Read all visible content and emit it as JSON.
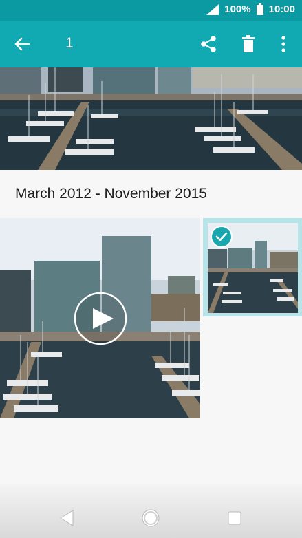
{
  "status": {
    "battery_text": "100%",
    "time": "10:00"
  },
  "app_bar": {
    "selected_count": "1"
  },
  "gallery": {
    "section_title": "March 2012 - November 2015"
  },
  "icons": {
    "back": "arrow-back-icon",
    "share": "share-icon",
    "delete": "trash-icon",
    "more": "more-vert-icon",
    "play": "play-icon",
    "check": "check-circle-icon",
    "nav_back": "triangle-back-icon",
    "nav_home": "circle-home-icon",
    "nav_recents": "square-recents-icon"
  },
  "colors": {
    "status_bar": "#0c9aa2",
    "app_bar": "#11aab2",
    "selection": "#b7e4e8",
    "check": "#1aa6ad"
  }
}
